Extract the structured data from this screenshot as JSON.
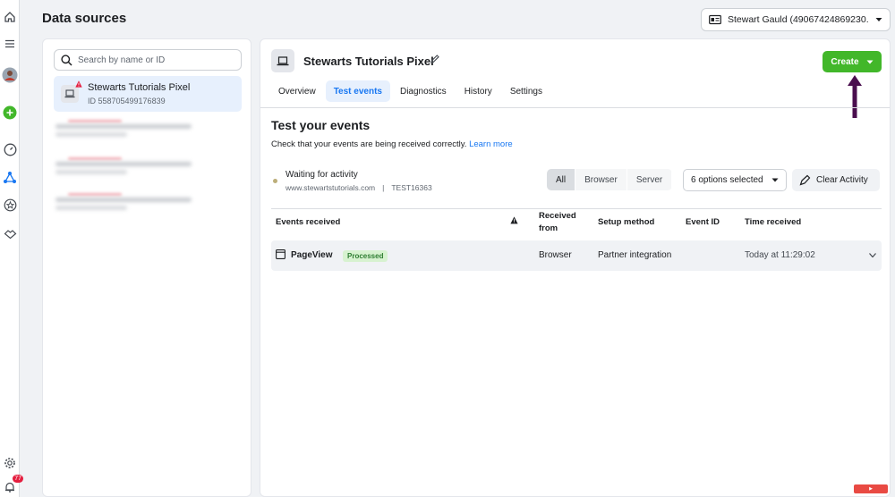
{
  "page": {
    "title": "Data sources"
  },
  "account": {
    "name": "Stewart Gauld (49067424869230..."
  },
  "search": {
    "placeholder": "Search by name or ID"
  },
  "sources": [
    {
      "name": "Stewarts Tutorials Pixel",
      "id": "ID 558705499176839"
    }
  ],
  "rail": {
    "notification_count": "77"
  },
  "pixel": {
    "name": "Stewarts Tutorials Pixel"
  },
  "create_button": {
    "label": "Create"
  },
  "tabs": [
    {
      "label": "Overview"
    },
    {
      "label": "Test events"
    },
    {
      "label": "Diagnostics"
    },
    {
      "label": "History"
    },
    {
      "label": "Settings"
    }
  ],
  "test_events": {
    "title": "Test your events",
    "description": "Check that your events are being received correctly.",
    "learn_more": "Learn more",
    "status": "Waiting for activity",
    "website": "www.stewartstutorials.com",
    "test_code": "TEST16363"
  },
  "filters": {
    "all": "All",
    "browser": "Browser",
    "server": "Server",
    "options": "6 options selected",
    "clear": "Clear Activity"
  },
  "table": {
    "headers": {
      "events": "Events received",
      "received_from_1": "Received",
      "received_from_2": "from",
      "setup": "Setup method",
      "event_id": "Event ID",
      "time": "Time received"
    },
    "rows": [
      {
        "event": "PageView",
        "status": "Processed",
        "from": "Browser",
        "setup": "Partner integration",
        "event_id": "",
        "time": "Today at 11:29:02"
      }
    ]
  },
  "colors": {
    "accent": "#1877f2",
    "create": "#42b72a",
    "arrow": "#4a0e4e"
  }
}
